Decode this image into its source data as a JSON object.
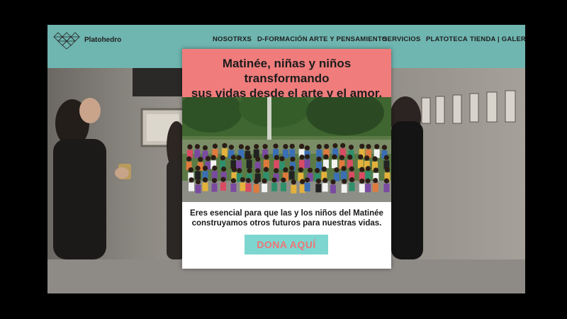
{
  "brand": {
    "name": "Platohedro",
    "logo_icon": "geometric-net-logo"
  },
  "nav": {
    "items": [
      {
        "label": "NOSOTRXS"
      },
      {
        "label": "D-FORMACIÓN"
      },
      {
        "label": "ARTE Y PENSAMIENTO"
      },
      {
        "label": "SERVICIOS"
      },
      {
        "label": "PLATOTECA"
      },
      {
        "label": "TIENDA | GALERÍA"
      }
    ]
  },
  "popup": {
    "title_line1": "Matinée, niñas y niños transformando",
    "title_line2": "sus vidas desde el arte y el amor.",
    "body_line1": "Eres esencial para que las y los niños del Matinée",
    "body_line2": "construyamos otros futuros para nuestras vidas.",
    "cta": "DONA AQUÍ"
  },
  "colors": {
    "nav_bg": "#6fb5b0",
    "popup_header": "#f07c7c",
    "cta_bg": "#7ed6d0",
    "cta_text": "#ef7575"
  }
}
